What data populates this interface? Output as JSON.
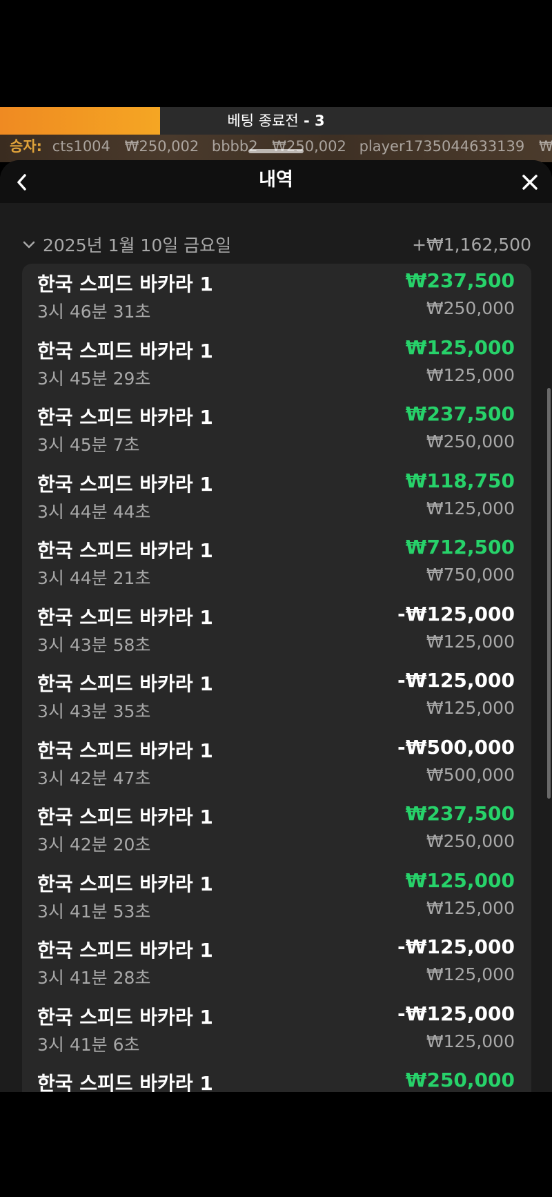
{
  "timer": {
    "label": "베팅 종료전",
    "separator": " - ",
    "count": "3",
    "progress": 0.29,
    "fill_color": "#f09a24"
  },
  "ticker": {
    "label": "승자:",
    "winners": [
      {
        "user": "cts1004",
        "amount": "₩250,002"
      },
      {
        "user": "bbbb2",
        "amount": "₩250,002"
      },
      {
        "user": "player1735044633139",
        "amount": "₩"
      }
    ]
  },
  "header": {
    "title": "내역",
    "back_icon": "chevron-left-icon",
    "close_icon": "close-icon"
  },
  "history": {
    "date": "2025년 1월 10일 금요일",
    "total": "+₩1,162,500",
    "win_color": "#27d26a",
    "entries": [
      {
        "game": "한국 스피드 바카라 1",
        "time": "3시 46분 31초",
        "result": "₩237,500",
        "bet": "₩250,000",
        "outcome": "win"
      },
      {
        "game": "한국 스피드 바카라 1",
        "time": "3시 45분 29초",
        "result": "₩125,000",
        "bet": "₩125,000",
        "outcome": "win"
      },
      {
        "game": "한국 스피드 바카라 1",
        "time": "3시 45분 7초",
        "result": "₩237,500",
        "bet": "₩250,000",
        "outcome": "win"
      },
      {
        "game": "한국 스피드 바카라 1",
        "time": "3시 44분 44초",
        "result": "₩118,750",
        "bet": "₩125,000",
        "outcome": "win"
      },
      {
        "game": "한국 스피드 바카라 1",
        "time": "3시 44분 21초",
        "result": "₩712,500",
        "bet": "₩750,000",
        "outcome": "win"
      },
      {
        "game": "한국 스피드 바카라 1",
        "time": "3시 43분 58초",
        "result": "-₩125,000",
        "bet": "₩125,000",
        "outcome": "loss"
      },
      {
        "game": "한국 스피드 바카라 1",
        "time": "3시 43분 35초",
        "result": "-₩125,000",
        "bet": "₩125,000",
        "outcome": "loss"
      },
      {
        "game": "한국 스피드 바카라 1",
        "time": "3시 42분 47초",
        "result": "-₩500,000",
        "bet": "₩500,000",
        "outcome": "loss"
      },
      {
        "game": "한국 스피드 바카라 1",
        "time": "3시 42분 20초",
        "result": "₩237,500",
        "bet": "₩250,000",
        "outcome": "win"
      },
      {
        "game": "한국 스피드 바카라 1",
        "time": "3시 41분 53초",
        "result": "₩125,000",
        "bet": "₩125,000",
        "outcome": "win"
      },
      {
        "game": "한국 스피드 바카라 1",
        "time": "3시 41분 28초",
        "result": "-₩125,000",
        "bet": "₩125,000",
        "outcome": "loss"
      },
      {
        "game": "한국 스피드 바카라 1",
        "time": "3시 41분 6초",
        "result": "-₩125,000",
        "bet": "₩125,000",
        "outcome": "loss"
      },
      {
        "game": "한국 스피드 바카라 1",
        "time": "",
        "result": "₩250,000",
        "bet": "",
        "outcome": "win"
      }
    ]
  }
}
